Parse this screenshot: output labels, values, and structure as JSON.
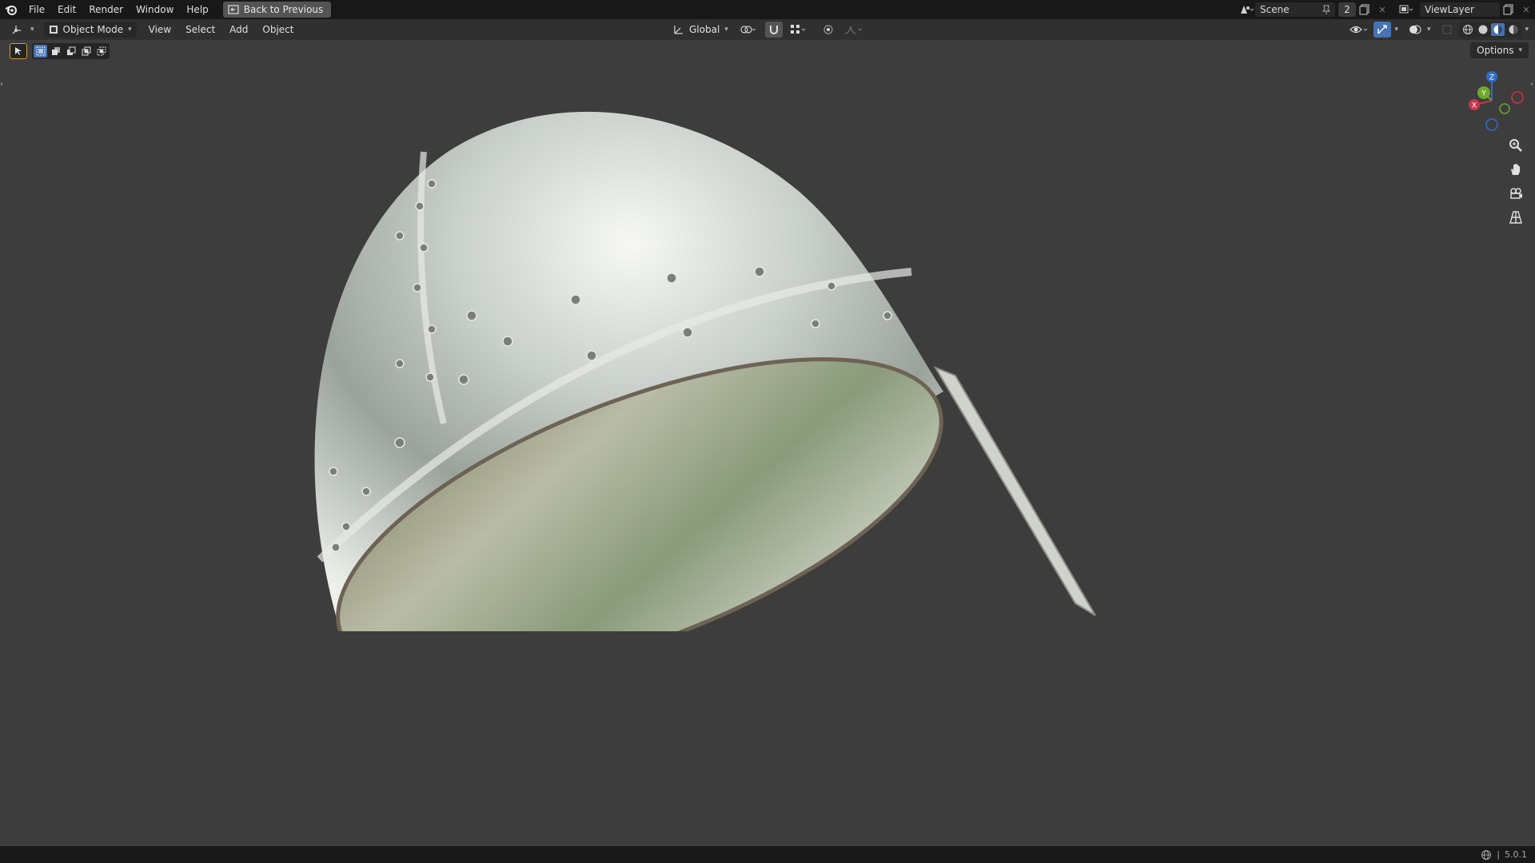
{
  "topbar": {
    "menus": [
      "File",
      "Edit",
      "Render",
      "Window",
      "Help"
    ],
    "back_button": "Back to Previous",
    "scene_name": "Scene",
    "scene_count": "2",
    "view_layer": "ViewLayer"
  },
  "header": {
    "mode": "Object Mode",
    "menus": [
      "View",
      "Select",
      "Add",
      "Object"
    ],
    "orientation": "Global"
  },
  "viewport": {
    "options_label": "Options",
    "gizmo_axes": {
      "z": "Z",
      "y": "Y",
      "x": "X"
    }
  },
  "statusbar": {
    "version": "5.0.1"
  },
  "colors": {
    "accent": "#4772b3",
    "axis_x": "#c8374c",
    "axis_y": "#70a82d",
    "axis_z": "#2f6fc6",
    "background": "#3d3d3d"
  },
  "icons": [
    "blender-logo-icon",
    "back-icon",
    "editor-type-icon",
    "object-mode-icon",
    "transform-orientation-icon",
    "pivot-icon",
    "snap-icon",
    "proportional-edit-icon",
    "visibility-icon",
    "gizmo-icon",
    "overlay-icon",
    "xray-icon",
    "wireframe-shading-icon",
    "solid-shading-icon",
    "material-shading-icon",
    "rendered-shading-icon",
    "zoom-icon",
    "pan-hand-icon",
    "camera-icon",
    "grid-perspective-icon",
    "network-icon"
  ]
}
